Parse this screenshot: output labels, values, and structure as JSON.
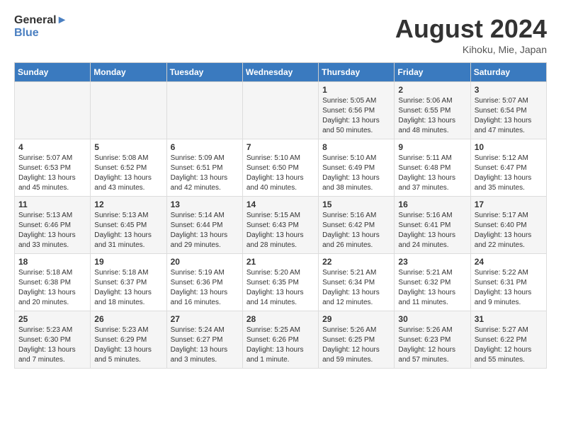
{
  "header": {
    "logo_line1": "General",
    "logo_line2": "Blue",
    "month_year": "August 2024",
    "location": "Kihoku, Mie, Japan"
  },
  "weekdays": [
    "Sunday",
    "Monday",
    "Tuesday",
    "Wednesday",
    "Thursday",
    "Friday",
    "Saturday"
  ],
  "weeks": [
    [
      {
        "day": "",
        "info": ""
      },
      {
        "day": "",
        "info": ""
      },
      {
        "day": "",
        "info": ""
      },
      {
        "day": "",
        "info": ""
      },
      {
        "day": "1",
        "info": "Sunrise: 5:05 AM\nSunset: 6:56 PM\nDaylight: 13 hours\nand 50 minutes."
      },
      {
        "day": "2",
        "info": "Sunrise: 5:06 AM\nSunset: 6:55 PM\nDaylight: 13 hours\nand 48 minutes."
      },
      {
        "day": "3",
        "info": "Sunrise: 5:07 AM\nSunset: 6:54 PM\nDaylight: 13 hours\nand 47 minutes."
      }
    ],
    [
      {
        "day": "4",
        "info": "Sunrise: 5:07 AM\nSunset: 6:53 PM\nDaylight: 13 hours\nand 45 minutes."
      },
      {
        "day": "5",
        "info": "Sunrise: 5:08 AM\nSunset: 6:52 PM\nDaylight: 13 hours\nand 43 minutes."
      },
      {
        "day": "6",
        "info": "Sunrise: 5:09 AM\nSunset: 6:51 PM\nDaylight: 13 hours\nand 42 minutes."
      },
      {
        "day": "7",
        "info": "Sunrise: 5:10 AM\nSunset: 6:50 PM\nDaylight: 13 hours\nand 40 minutes."
      },
      {
        "day": "8",
        "info": "Sunrise: 5:10 AM\nSunset: 6:49 PM\nDaylight: 13 hours\nand 38 minutes."
      },
      {
        "day": "9",
        "info": "Sunrise: 5:11 AM\nSunset: 6:48 PM\nDaylight: 13 hours\nand 37 minutes."
      },
      {
        "day": "10",
        "info": "Sunrise: 5:12 AM\nSunset: 6:47 PM\nDaylight: 13 hours\nand 35 minutes."
      }
    ],
    [
      {
        "day": "11",
        "info": "Sunrise: 5:13 AM\nSunset: 6:46 PM\nDaylight: 13 hours\nand 33 minutes."
      },
      {
        "day": "12",
        "info": "Sunrise: 5:13 AM\nSunset: 6:45 PM\nDaylight: 13 hours\nand 31 minutes."
      },
      {
        "day": "13",
        "info": "Sunrise: 5:14 AM\nSunset: 6:44 PM\nDaylight: 13 hours\nand 29 minutes."
      },
      {
        "day": "14",
        "info": "Sunrise: 5:15 AM\nSunset: 6:43 PM\nDaylight: 13 hours\nand 28 minutes."
      },
      {
        "day": "15",
        "info": "Sunrise: 5:16 AM\nSunset: 6:42 PM\nDaylight: 13 hours\nand 26 minutes."
      },
      {
        "day": "16",
        "info": "Sunrise: 5:16 AM\nSunset: 6:41 PM\nDaylight: 13 hours\nand 24 minutes."
      },
      {
        "day": "17",
        "info": "Sunrise: 5:17 AM\nSunset: 6:40 PM\nDaylight: 13 hours\nand 22 minutes."
      }
    ],
    [
      {
        "day": "18",
        "info": "Sunrise: 5:18 AM\nSunset: 6:38 PM\nDaylight: 13 hours\nand 20 minutes."
      },
      {
        "day": "19",
        "info": "Sunrise: 5:18 AM\nSunset: 6:37 PM\nDaylight: 13 hours\nand 18 minutes."
      },
      {
        "day": "20",
        "info": "Sunrise: 5:19 AM\nSunset: 6:36 PM\nDaylight: 13 hours\nand 16 minutes."
      },
      {
        "day": "21",
        "info": "Sunrise: 5:20 AM\nSunset: 6:35 PM\nDaylight: 13 hours\nand 14 minutes."
      },
      {
        "day": "22",
        "info": "Sunrise: 5:21 AM\nSunset: 6:34 PM\nDaylight: 13 hours\nand 12 minutes."
      },
      {
        "day": "23",
        "info": "Sunrise: 5:21 AM\nSunset: 6:32 PM\nDaylight: 13 hours\nand 11 minutes."
      },
      {
        "day": "24",
        "info": "Sunrise: 5:22 AM\nSunset: 6:31 PM\nDaylight: 13 hours\nand 9 minutes."
      }
    ],
    [
      {
        "day": "25",
        "info": "Sunrise: 5:23 AM\nSunset: 6:30 PM\nDaylight: 13 hours\nand 7 minutes."
      },
      {
        "day": "26",
        "info": "Sunrise: 5:23 AM\nSunset: 6:29 PM\nDaylight: 13 hours\nand 5 minutes."
      },
      {
        "day": "27",
        "info": "Sunrise: 5:24 AM\nSunset: 6:27 PM\nDaylight: 13 hours\nand 3 minutes."
      },
      {
        "day": "28",
        "info": "Sunrise: 5:25 AM\nSunset: 6:26 PM\nDaylight: 13 hours\nand 1 minute."
      },
      {
        "day": "29",
        "info": "Sunrise: 5:26 AM\nSunset: 6:25 PM\nDaylight: 12 hours\nand 59 minutes."
      },
      {
        "day": "30",
        "info": "Sunrise: 5:26 AM\nSunset: 6:23 PM\nDaylight: 12 hours\nand 57 minutes."
      },
      {
        "day": "31",
        "info": "Sunrise: 5:27 AM\nSunset: 6:22 PM\nDaylight: 12 hours\nand 55 minutes."
      }
    ]
  ]
}
